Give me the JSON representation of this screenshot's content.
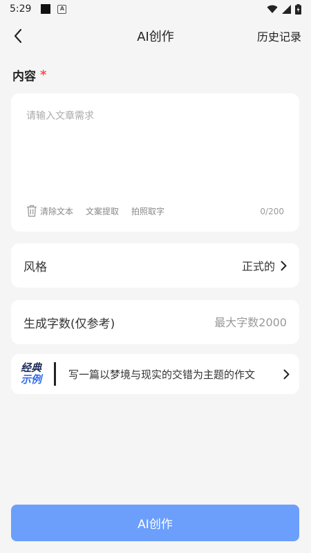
{
  "status_bar": {
    "time": "5:29",
    "notification_icons": [
      "square-icon",
      "a-badge-icon"
    ],
    "right_icons": [
      "wifi-icon",
      "signal-icon",
      "battery-icon"
    ]
  },
  "nav": {
    "back_icon": "chevron-left-icon",
    "title": "AI创作",
    "history_label": "历史记录"
  },
  "content": {
    "label": "内容",
    "required_mark": "*",
    "placeholder": "请输入文章需求",
    "value": "",
    "tools": {
      "clear_label": "清除文本",
      "extract_label": "文案提取",
      "photo_label": "拍照取字"
    },
    "char_count": "0/200"
  },
  "style": {
    "label": "风格",
    "value": "正式的"
  },
  "word_count": {
    "label": "生成字数(仅参考)",
    "placeholder": "最大字数2000",
    "value": ""
  },
  "example": {
    "badge_line1": "经典",
    "badge_line2": "示例",
    "text": "写一篇以梦境与现实的交错为主题的作文"
  },
  "submit": {
    "label": "AI创作"
  },
  "colors": {
    "primary_button": "#6c9ffb",
    "required_star": "#ff4d4f",
    "badge_blue": "#2e6bf0",
    "page_bg": "#f5f5f5"
  }
}
